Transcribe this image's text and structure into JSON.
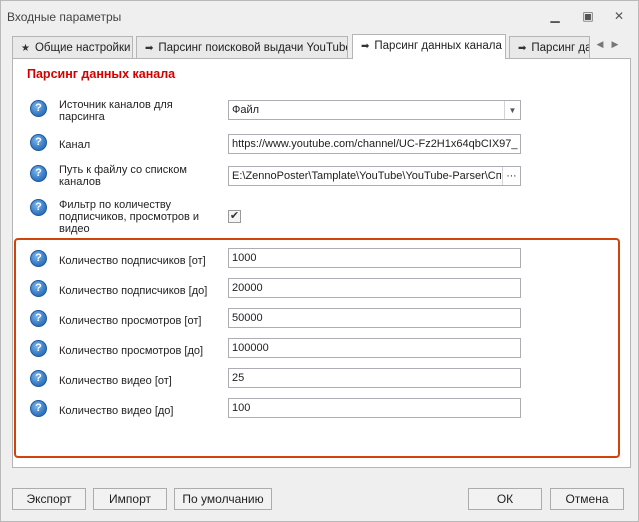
{
  "window": {
    "title": "Входные параметры"
  },
  "tabs": [
    {
      "glyph": "★",
      "label": "Общие настройки"
    },
    {
      "glyph": "➡",
      "label": "Парсинг поисковой выдачи YouTube"
    },
    {
      "glyph": "➡",
      "label": "Парсинг данных канала"
    },
    {
      "glyph": "➡",
      "label": "Парсинг дан"
    }
  ],
  "section_title": "Парсинг данных канала",
  "fields": {
    "source": {
      "label": "Источник каналов для парсинга",
      "value": "Файл"
    },
    "channel": {
      "label": "Канал",
      "value": "https://www.youtube.com/channel/UC-Fz2H1x64qbCIX97_"
    },
    "path": {
      "label": "Путь к файлу со списком каналов",
      "value": "E:\\ZennoPoster\\Tamplate\\YouTube\\YouTube-Parser\\Спи"
    },
    "filter": {
      "label": "Фильтр по количеству подписчиков, просмотров и видео",
      "checked": true,
      "check_glyph": "✔"
    },
    "subs_from": {
      "label": "Количество подписчиков [от]",
      "value": "1000"
    },
    "subs_to": {
      "label": "Количество подписчиков [до]",
      "value": "20000"
    },
    "views_from": {
      "label": "Количество просмотров [от]",
      "value": "50000"
    },
    "views_to": {
      "label": "Количество просмотров [до]",
      "value": "100000"
    },
    "videos_from": {
      "label": "Количество видео [от]",
      "value": "25"
    },
    "videos_to": {
      "label": "Количество видео [до]",
      "value": "100"
    }
  },
  "buttons": {
    "export": "Экспорт",
    "import": "Импорт",
    "default": "По умолчанию",
    "ok": "ОК",
    "cancel": "Отмена"
  },
  "icons": {
    "help": "question-mark-icon",
    "minimize": "minimize-icon",
    "restore": "restore-icon",
    "close": "close-icon"
  },
  "colors": {
    "section_title": "#d40000",
    "highlight_border": "#d2430c",
    "help_icon": "#3b7fc8"
  }
}
